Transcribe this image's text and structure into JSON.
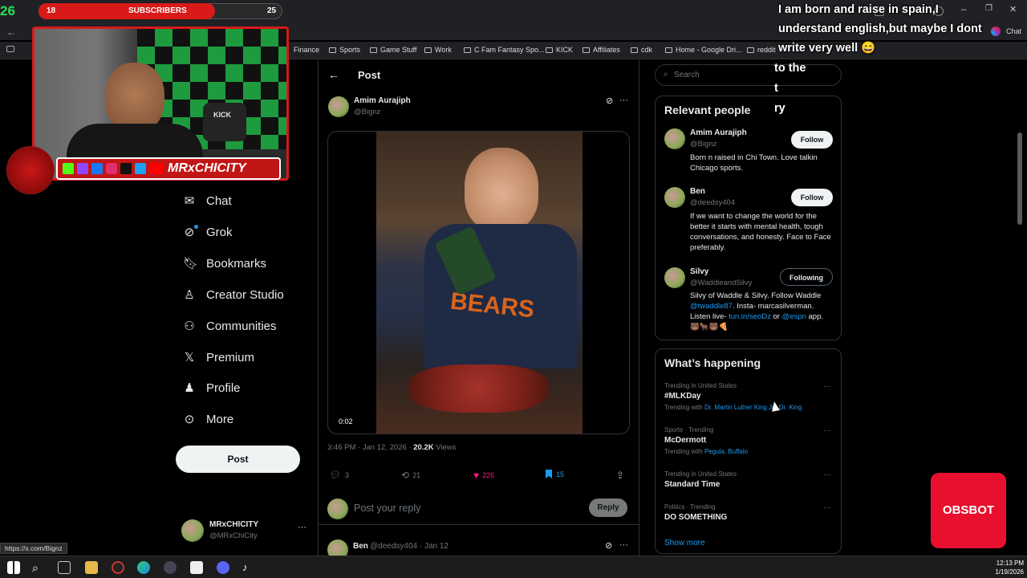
{
  "overlay": {
    "sub_goal_current": "26",
    "sub_count_left": "18",
    "sub_label": "SUBSCRIBERS",
    "sub_count_right": "25",
    "streamer_name": "MRxCHICITY",
    "webcam_shirt": "KICK",
    "obsbot_label": "OBSBOT",
    "chat_message": "I am born and raise in spain,I understand english,but maybe I dont write very well 😄",
    "chat_overlap_1": "to the",
    "chat_overlap_2": "t",
    "chat_overlap_3": "ry"
  },
  "browser": {
    "chat_tab": "Chat",
    "bookmarks": [
      "Finance",
      "Sports",
      "Game Stuff",
      "Work",
      "C Fam Fantasy Spo...",
      "KICK",
      "Affiliates",
      "cdk",
      "Home - Google Dri...",
      "reddit"
    ],
    "status_url": "https://x.com/Bignz"
  },
  "nav": {
    "items": [
      {
        "label": "Chat",
        "icon": "mail-icon"
      },
      {
        "label": "Grok",
        "icon": "grok-icon"
      },
      {
        "label": "Bookmarks",
        "icon": "bookmark-icon"
      },
      {
        "label": "Creator Studio",
        "icon": "creator-studio-icon"
      },
      {
        "label": "Communities",
        "icon": "communities-icon"
      },
      {
        "label": "Premium",
        "icon": "x-logo-icon"
      },
      {
        "label": "Profile",
        "icon": "person-icon"
      },
      {
        "label": "More",
        "icon": "more-circle-icon"
      }
    ],
    "post_button": "Post",
    "account_name": "MRxCHICITY",
    "account_handle": "@MRxChiCity"
  },
  "post": {
    "header_title": "Post",
    "author_name": "Amim Aurajiph",
    "author_handle": "@Bignz",
    "video_time": "0:02",
    "meta_time": "3:46 PM · Jan 12, 2026 · ",
    "views_count": "20.2K",
    "views_label": " Views",
    "replies": "3",
    "reposts": "21",
    "likes": "226",
    "bookmarks": "15",
    "reply_placeholder": "Post your reply",
    "reply_button": "Reply",
    "next_reply_name": "Ben",
    "next_reply_meta": "@deedsy404 · Jan 12"
  },
  "search": {
    "placeholder": "Search"
  },
  "relevant": {
    "title": "Relevant people",
    "people": [
      {
        "name": "Amim Aurajiph",
        "handle": "@Bignz",
        "button": "Follow",
        "bio": "Born n raised in Chi Town. Love talkin Chicago sports."
      },
      {
        "name": "Ben",
        "handle": "@deedsy404",
        "button": "Follow",
        "bio": "If we want to change the world for the better it starts with mental health, tough conversations, and honesty. Face to Face preferably."
      },
      {
        "name": "Silvy",
        "handle": "@WaddleandSilvy",
        "button": "Following",
        "bio_1": "Silvy of Waddle & Silvy. Follow Waddle ",
        "bio_link1": "@twaddle87",
        "bio_2": ". Insta- marcasilverman. Listen live- ",
        "bio_link2": "tun.in/seoDz",
        "bio_3": " or ",
        "bio_link3": "@espn",
        "bio_4": " app. 🐻🐂🐻🍕"
      }
    ]
  },
  "happening": {
    "title": "What’s happening",
    "trends": [
      {
        "category": "Trending in United States",
        "name": "#MLKDay",
        "with_label": "Trending with ",
        "with_links": "Dr. Martin Luther King Jr., Dr. King"
      },
      {
        "category": "Sports · Trending",
        "name": "McDermott",
        "with_label": "Trending with ",
        "with_links": "Pegula, Buffalo"
      },
      {
        "category": "Trending in United States",
        "name": "Standard Time",
        "with_label": "",
        "with_links": ""
      },
      {
        "category": "Politics · Trending",
        "name": "DO SOMETHING",
        "with_label": "",
        "with_links": ""
      }
    ],
    "show_more": "Show more"
  },
  "taskbar": {
    "time": "12:13 PM",
    "date": "1/19/2026"
  }
}
